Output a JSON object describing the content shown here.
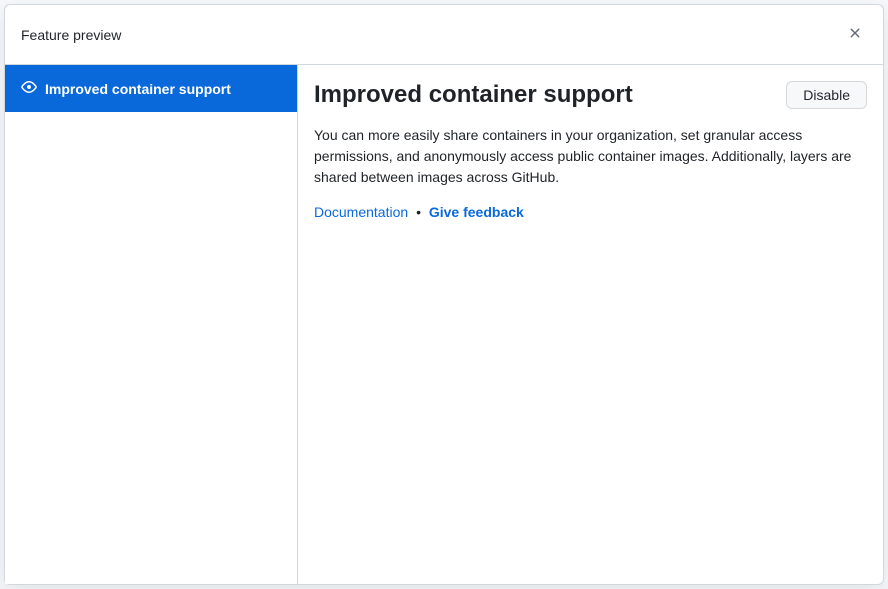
{
  "header": {
    "title": "Feature preview"
  },
  "sidebar": {
    "items": [
      {
        "label": "Improved container support"
      }
    ]
  },
  "content": {
    "title": "Improved container support",
    "disable_label": "Disable",
    "description": "You can more easily share containers in your organization, set granular access permissions, and anonymously access public container images. Additionally, layers are shared between images across GitHub.",
    "documentation_label": "Documentation",
    "separator": "•",
    "feedback_label": "Give feedback"
  }
}
